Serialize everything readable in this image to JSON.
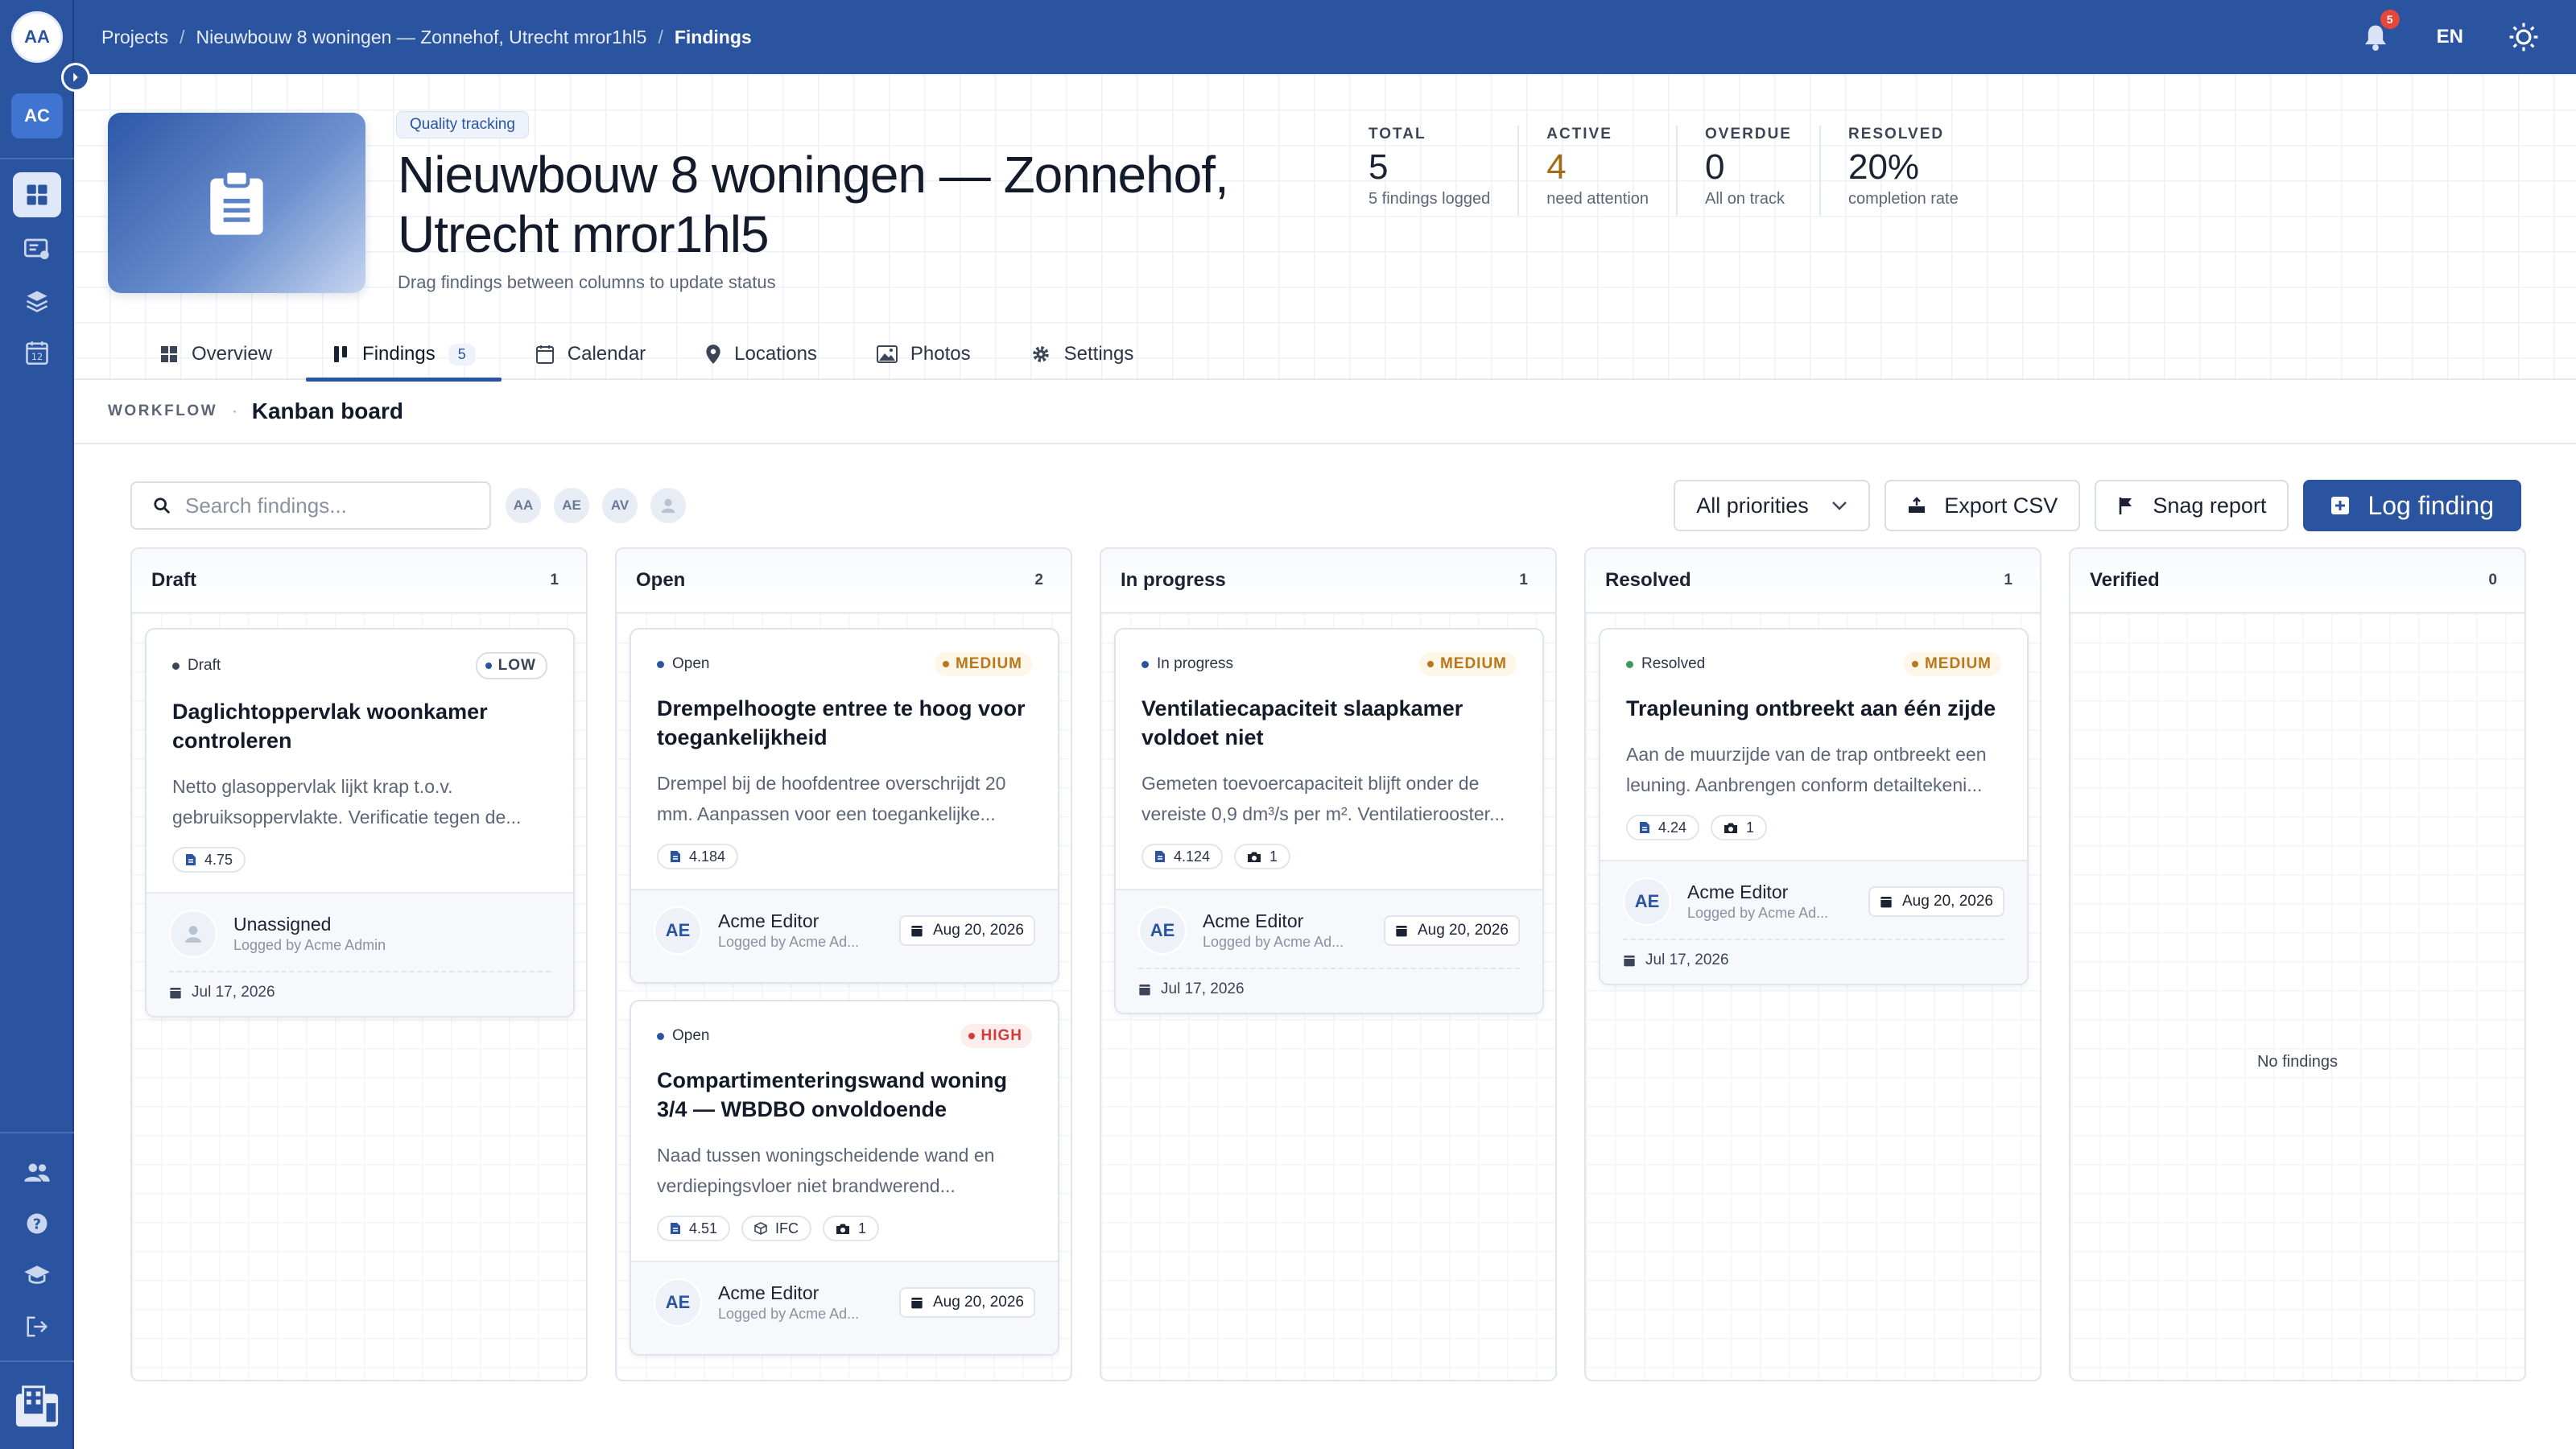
{
  "rail": {
    "user_initials": "AA",
    "workspace_initials": "AC"
  },
  "topbar": {
    "breadcrumbs": [
      "Projects",
      "Nieuwbouw 8 woningen — Zonnehof, Utrecht mror1hl5",
      "Findings"
    ],
    "notifications_count": "5",
    "language": "EN"
  },
  "header": {
    "chip": "Quality tracking",
    "title": "Nieuwbouw 8 woningen — Zonnehof, Utrecht mror1hl5",
    "subtitle": "Drag findings between columns to update status",
    "stats": [
      {
        "label": "TOTAL",
        "value": "5",
        "caption": "5 findings logged"
      },
      {
        "label": "ACTIVE",
        "value": "4",
        "caption": "need attention"
      },
      {
        "label": "OVERDUE",
        "value": "0",
        "caption": "All on track"
      },
      {
        "label": "RESOLVED",
        "value": "20%",
        "caption": "completion rate"
      }
    ]
  },
  "tabs": [
    {
      "label": "Overview"
    },
    {
      "label": "Findings",
      "count": "5"
    },
    {
      "label": "Calendar"
    },
    {
      "label": "Locations"
    },
    {
      "label": "Photos"
    },
    {
      "label": "Settings"
    }
  ],
  "workflow": {
    "label": "WORKFLOW",
    "title": "Kanban board"
  },
  "toolbar": {
    "search_placeholder": "Search findings...",
    "avatar_filters": [
      "AA",
      "AE",
      "AV"
    ],
    "priority_filter": "All priorities",
    "export_label": "Export CSV",
    "snag_label": "Snag report",
    "log_label": "Log finding"
  },
  "columns": [
    {
      "title": "Draft",
      "count": "1",
      "cards": [
        {
          "status": "Draft",
          "priority": "LOW",
          "title": "Daglichtoppervlak woonkamer controleren",
          "desc": "Netto glasoppervlak lijkt krap t.o.v. gebruiksoppervlakte. Verificatie tegen de...",
          "tags": [
            "4.75"
          ],
          "assignee": "Unassigned",
          "logged_by": "Logged by Acme Admin",
          "due": "Jul 17, 2026"
        }
      ]
    },
    {
      "title": "Open",
      "count": "2",
      "cards": [
        {
          "status": "Open",
          "priority": "MEDIUM",
          "title": "Drempelhoogte entree te hoog voor toegankelijkheid",
          "desc": "Drempel bij de hoofdentree overschrijdt 20 mm. Aanpassen voor een toegankelijke...",
          "tags": [
            "4.184"
          ],
          "assignee_initials": "AE",
          "assignee": "Acme Editor",
          "logged_by": "Logged by Acme Ad...",
          "date": "Aug 20, 2026"
        },
        {
          "status": "Open",
          "priority": "HIGH",
          "title": "Compartimenteringswand woning 3/4 — WBDBO onvoldoende",
          "desc": "Naad tussen woningscheidende wand en verdiepingsvloer niet brandwerend...",
          "tags": [
            "4.51",
            "IFC",
            "1"
          ],
          "assignee_initials": "AE",
          "assignee": "Acme Editor",
          "logged_by": "Logged by Acme Ad...",
          "date": "Aug 20, 2026"
        }
      ]
    },
    {
      "title": "In progress",
      "count": "1",
      "cards": [
        {
          "status": "In progress",
          "priority": "MEDIUM",
          "title": "Ventilatiecapaciteit slaapkamer voldoet niet",
          "desc": "Gemeten toevoercapaciteit blijft onder de vereiste 0,9 dm³/s per m². Ventilatierooster...",
          "tags": [
            "4.124",
            "1"
          ],
          "assignee_initials": "AE",
          "assignee": "Acme Editor",
          "logged_by": "Logged by Acme Ad...",
          "date": "Aug 20, 2026",
          "due": "Jul 17, 2026"
        }
      ]
    },
    {
      "title": "Resolved",
      "count": "1",
      "cards": [
        {
          "status": "Resolved",
          "priority": "MEDIUM",
          "title": "Trapleuning ontbreekt aan één zijde",
          "desc": "Aan de muurzijde van de trap ontbreekt een leuning. Aanbrengen conform detailtekeni...",
          "tags": [
            "4.24",
            "1"
          ],
          "assignee_initials": "AE",
          "assignee": "Acme Editor",
          "logged_by": "Logged by Acme Ad...",
          "date": "Aug 20, 2026",
          "due": "Jul 17, 2026"
        }
      ]
    },
    {
      "title": "Verified",
      "count": "0",
      "empty": "No findings"
    }
  ],
  "colors": {
    "brand": "#2b54a0",
    "active_stat": "#a36b16",
    "medium": "#b8771a",
    "high": "#d23c3c",
    "status_draft": "#3c4557",
    "status_open": "#2b54a0",
    "status_progress": "#2b54a0",
    "status_resolved": "#3a9b5c"
  }
}
